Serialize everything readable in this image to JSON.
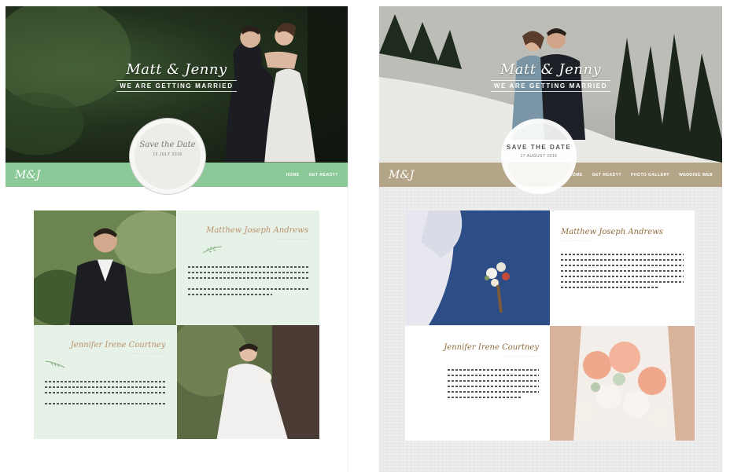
{
  "left": {
    "hero": {
      "names": "Matt & Jenny",
      "tagline": "WE ARE GETTING MARRIED"
    },
    "badge": {
      "title": "Save the Date",
      "date": "15 JULY 2016"
    },
    "nav": {
      "logo": "M&J",
      "links": [
        "HOME",
        "GET READY?"
      ]
    },
    "groom": {
      "name": "Matthew Joseph Andrews"
    },
    "bride": {
      "name": "Jennifer Irene Courtney"
    }
  },
  "right": {
    "hero": {
      "names": "Matt & Jenny",
      "tagline": "WE ARE GETTING MARRIED"
    },
    "badge": {
      "title": "SAVE THE DATE",
      "date": "17 AUGUST 2016"
    },
    "nav": {
      "logo": "M&J",
      "links": [
        "HOME",
        "GET READY?",
        "PHOTO GALLERY",
        "WEDDING WEB"
      ]
    },
    "groom": {
      "name": "Matthew Joseph Andrews"
    },
    "bride": {
      "name": "Jennifer Irene Courtney"
    }
  },
  "colors": {
    "nav_green": "#8cc998",
    "nav_tan": "#b5a588",
    "panel_mint": "#e6f1e7"
  },
  "icons": [
    "leaf-icon"
  ]
}
